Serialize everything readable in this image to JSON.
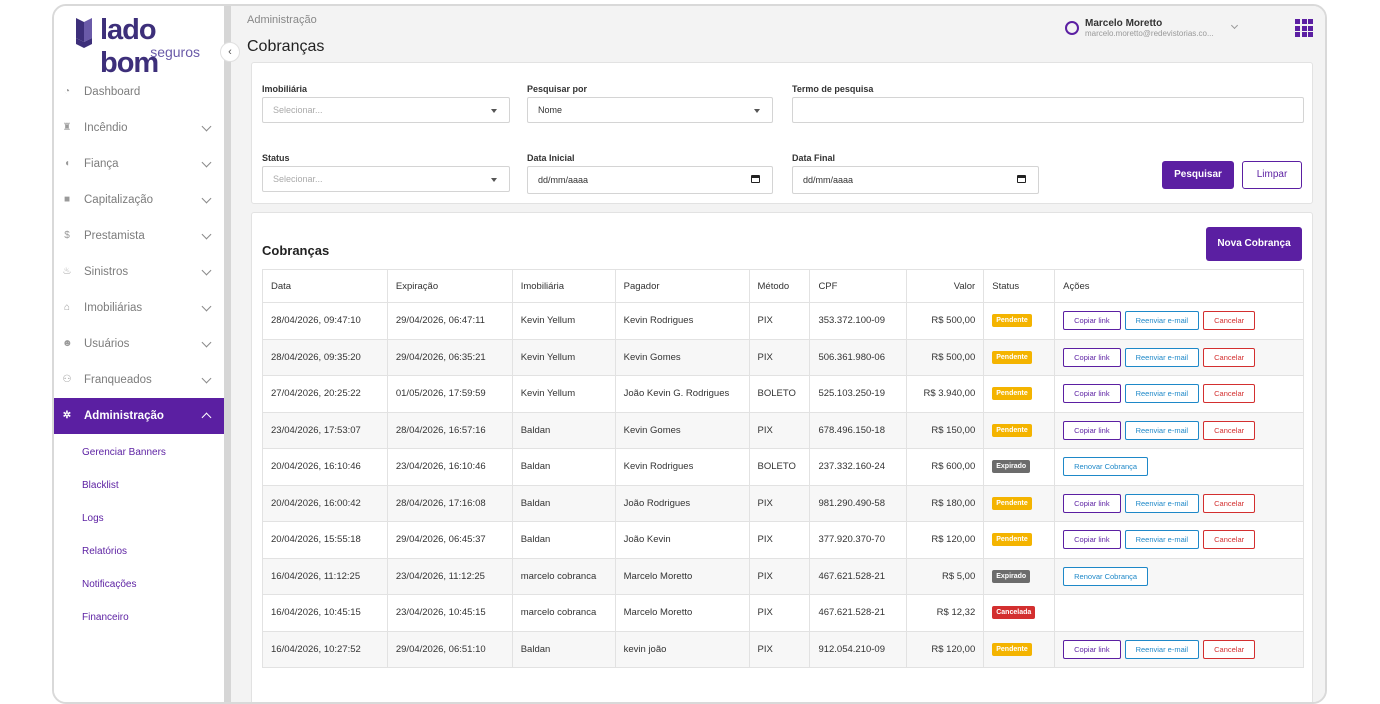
{
  "brand": {
    "name": "lado bom",
    "sub": "seguros",
    "accent": "#5b1fa2"
  },
  "sidebar": {
    "items": [
      {
        "label": "Dashboard",
        "icon": "gauge-icon",
        "glyph": "◔",
        "chevron": false
      },
      {
        "label": "Incêndio",
        "icon": "fire-extinguisher-icon",
        "glyph": "♜",
        "chevron": true
      },
      {
        "label": "Fiança",
        "icon": "shield-icon",
        "glyph": "◖",
        "chevron": true
      },
      {
        "label": "Capitalização",
        "icon": "lock-icon",
        "glyph": "■",
        "chevron": true
      },
      {
        "label": "Prestamista",
        "icon": "dollar-icon",
        "glyph": "$",
        "chevron": true
      },
      {
        "label": "Sinistros",
        "icon": "fire-icon",
        "glyph": "♨",
        "chevron": true
      },
      {
        "label": "Imobiliárias",
        "icon": "home-icon",
        "glyph": "⌂",
        "chevron": true
      },
      {
        "label": "Usuários",
        "icon": "users-icon",
        "glyph": "☻",
        "chevron": true
      },
      {
        "label": "Franqueados",
        "icon": "handshake-icon",
        "glyph": "⚇",
        "chevron": true
      },
      {
        "label": "Administração",
        "icon": "gear-icon",
        "glyph": "✲",
        "chevron": true
      }
    ],
    "subitems": [
      "Gerenciar Banners",
      "Blacklist",
      "Logs",
      "Relatórios",
      "Notificações",
      "Financeiro"
    ]
  },
  "header": {
    "breadcrumb": "Administração",
    "title": "Cobranças",
    "user_name": "Marcelo Moretto",
    "user_email": "marcelo.moretto@redevistorias.co..."
  },
  "filters": {
    "imobiliaria_label": "Imobiliária",
    "imobiliaria_placeholder": "Selecionar...",
    "pesquisar_por_label": "Pesquisar por",
    "pesquisar_por_value": "Nome",
    "termo_label": "Termo de pesquisa",
    "termo_value": "",
    "status_label": "Status",
    "status_placeholder": "Selecionar...",
    "data_inicial_label": "Data Inicial",
    "data_inicial_value": "dd/mm/aaaa",
    "data_final_label": "Data Final",
    "data_final_value": "dd/mm/aaaa",
    "search_button": "Pesquisar",
    "clear_button": "Limpar"
  },
  "table": {
    "title": "Cobranças",
    "new_button": "Nova Cobrança",
    "columns": [
      "Data",
      "Expiração",
      "Imobiliária",
      "Pagador",
      "Método",
      "CPF",
      "Valor",
      "Status",
      "Ações"
    ],
    "action_labels": {
      "copy": "Copiar link",
      "resend": "Reenviar e-mail",
      "cancel": "Cancelar",
      "renew": "Renovar Cobrança"
    },
    "status_colors": {
      "Pendente": "#f4b400",
      "Expirado": "#6c6c6c",
      "Cancelada": "#d32f2f"
    },
    "rows": [
      {
        "data": "28/04/2026, 09:47:10",
        "exp": "29/04/2026, 06:47:11",
        "imob": "Kevin Yellum",
        "pagador": "Kevin Rodrigues",
        "metodo": "PIX",
        "cpf": "353.372.100-09",
        "valor": "R$ 500,00",
        "status": "Pendente"
      },
      {
        "data": "28/04/2026, 09:35:20",
        "exp": "29/04/2026, 06:35:21",
        "imob": "Kevin Yellum",
        "pagador": "Kevin Gomes",
        "metodo": "PIX",
        "cpf": "506.361.980-06",
        "valor": "R$ 500,00",
        "status": "Pendente"
      },
      {
        "data": "27/04/2026, 20:25:22",
        "exp": "01/05/2026, 17:59:59",
        "imob": "Kevin Yellum",
        "pagador": "João Kevin G. Rodrigues",
        "metodo": "BOLETO",
        "cpf": "525.103.250-19",
        "valor": "R$ 3.940,00",
        "status": "Pendente"
      },
      {
        "data": "23/04/2026, 17:53:07",
        "exp": "28/04/2026, 16:57:16",
        "imob": "Baldan",
        "pagador": "Kevin Gomes",
        "metodo": "PIX",
        "cpf": "678.496.150-18",
        "valor": "R$ 150,00",
        "status": "Pendente"
      },
      {
        "data": "20/04/2026, 16:10:46",
        "exp": "23/04/2026, 16:10:46",
        "imob": "Baldan",
        "pagador": "Kevin Rodrigues",
        "metodo": "BOLETO",
        "cpf": "237.332.160-24",
        "valor": "R$ 600,00",
        "status": "Expirado"
      },
      {
        "data": "20/04/2026, 16:00:42",
        "exp": "28/04/2026, 17:16:08",
        "imob": "Baldan",
        "pagador": "João Rodrigues",
        "metodo": "PIX",
        "cpf": "981.290.490-58",
        "valor": "R$ 180,00",
        "status": "Pendente"
      },
      {
        "data": "20/04/2026, 15:55:18",
        "exp": "29/04/2026, 06:45:37",
        "imob": "Baldan",
        "pagador": "João Kevin",
        "metodo": "PIX",
        "cpf": "377.920.370-70",
        "valor": "R$ 120,00",
        "status": "Pendente"
      },
      {
        "data": "16/04/2026, 11:12:25",
        "exp": "23/04/2026, 11:12:25",
        "imob": "marcelo cobranca",
        "pagador": "Marcelo Moretto",
        "metodo": "PIX",
        "cpf": "467.621.528-21",
        "valor": "R$ 5,00",
        "status": "Expirado"
      },
      {
        "data": "16/04/2026, 10:45:15",
        "exp": "23/04/2026, 10:45:15",
        "imob": "marcelo cobranca",
        "pagador": "Marcelo Moretto",
        "metodo": "PIX",
        "cpf": "467.621.528-21",
        "valor": "R$ 12,32",
        "status": "Cancelada"
      },
      {
        "data": "16/04/2026, 10:27:52",
        "exp": "29/04/2026, 06:51:10",
        "imob": "Baldan",
        "pagador": "kevin joão",
        "metodo": "PIX",
        "cpf": "912.054.210-09",
        "valor": "R$ 120,00",
        "status": "Pendente"
      }
    ]
  }
}
